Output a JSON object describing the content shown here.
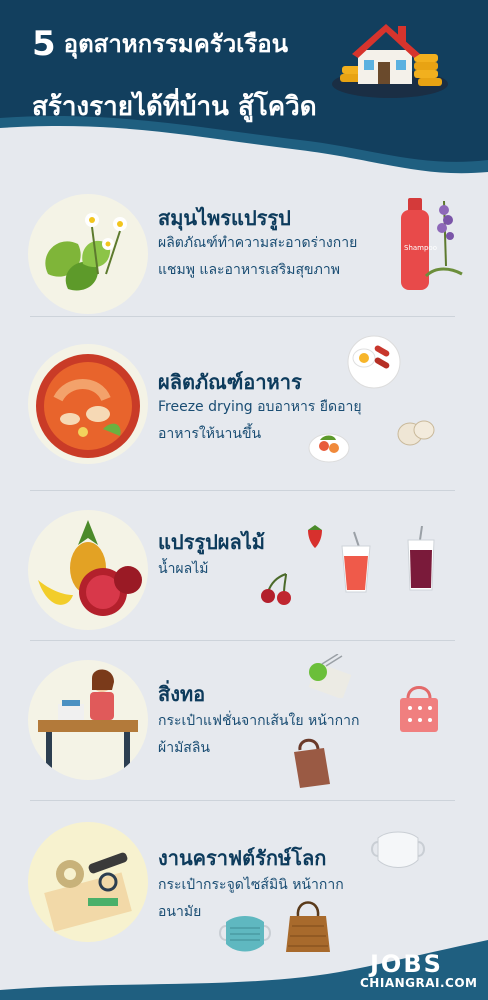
{
  "header": {
    "number": "5",
    "title_line1": "อุตสาหกรรมครัวเรือน",
    "title_line2": "สร้างรายได้ที่บ้าน สู้โควิด"
  },
  "items": [
    {
      "heading": "สมุนไพรแปรรูป",
      "desc1": "ผลิตภัณฑ์ทำความสะอาดร่างกาย",
      "desc2": "แชมพู และอาหารเสริมสุขภาพ",
      "bottle_label": "Shampoo"
    },
    {
      "heading": "ผลิตภัณฑ์อาหาร",
      "desc1": "Freeze drying อบอาหาร ยืดอายุ",
      "desc2": "อาหารให้นานขึ้น"
    },
    {
      "heading": "แปรรูปผลไม้",
      "desc1": "น้ำผลไม้"
    },
    {
      "heading": "สิ่งทอ",
      "desc1": "กระเป๋าแฟชั่นจากเส้นใย หน้ากาก",
      "desc2": "ผ้ามัสลิน"
    },
    {
      "heading": "งานคราฟต์รักษ์โลก",
      "desc1": "กระเป๋ากระจูดไซส์มินิ หน้ากาก",
      "desc2": "อนามัย"
    }
  ],
  "logo": {
    "line1": "JOBS",
    "line2": "CHIANGRAI.COM"
  },
  "colors": {
    "navy": "#0d3b5c",
    "teal": "#1f5f80",
    "background": "#e6e9ee",
    "text_blue": "#1a4d73"
  }
}
